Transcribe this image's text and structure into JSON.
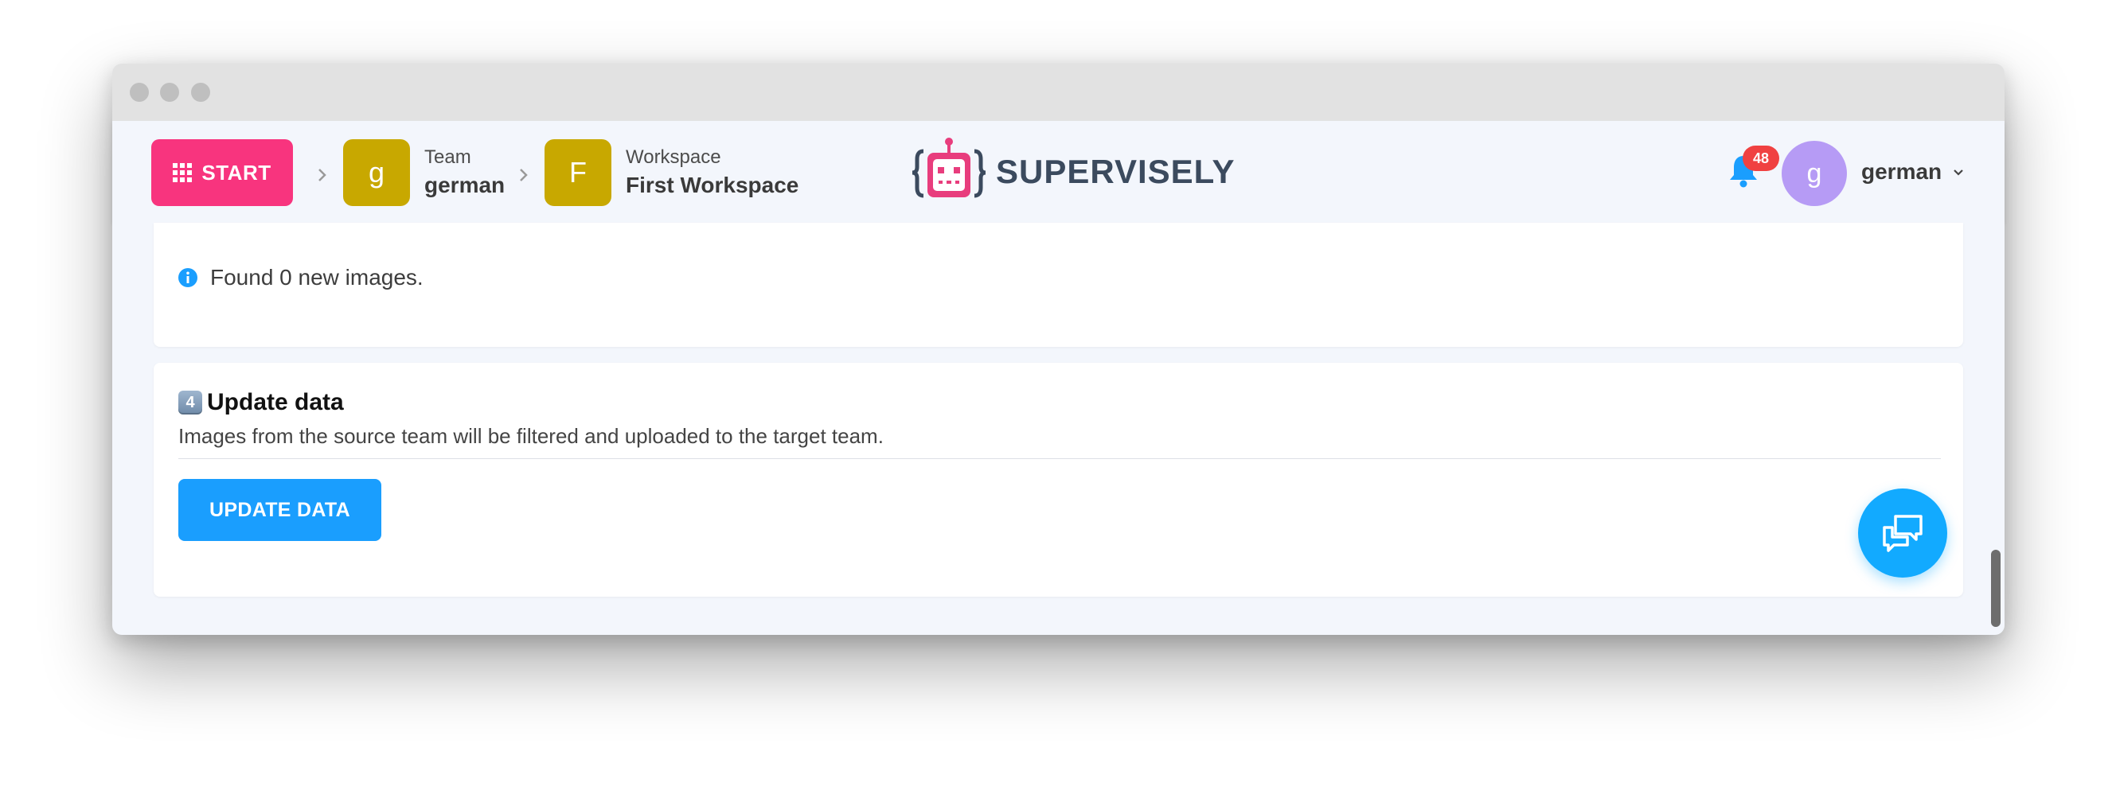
{
  "navbar": {
    "start_label": "START",
    "team": {
      "initial": "g",
      "caption": "Team",
      "name": "german"
    },
    "workspace": {
      "initial": "F",
      "caption": "Workspace",
      "name": "First Workspace"
    },
    "brand": "SUPERVISELY",
    "notifications_count": "48",
    "user": {
      "initial": "g",
      "name": "german"
    }
  },
  "info": {
    "message": "Found 0 new images."
  },
  "update_section": {
    "number_badge": "4",
    "title": "Update data",
    "description": "Images from the source team will be filtered and uploaded to the target team.",
    "button_label": "UPDATE DATA"
  },
  "colors": {
    "start": "#f8347e",
    "tile": "#c8a800",
    "avatar": "#b69bf5",
    "primary_button": "#1a9efe",
    "chat_fab": "#12aaff",
    "badge": "#f04141"
  },
  "icons": [
    "grid-icon",
    "chevron-right-icon",
    "supervisely-robot-logo",
    "bell-icon",
    "chevron-down-icon",
    "info-icon",
    "chat-icon"
  ]
}
